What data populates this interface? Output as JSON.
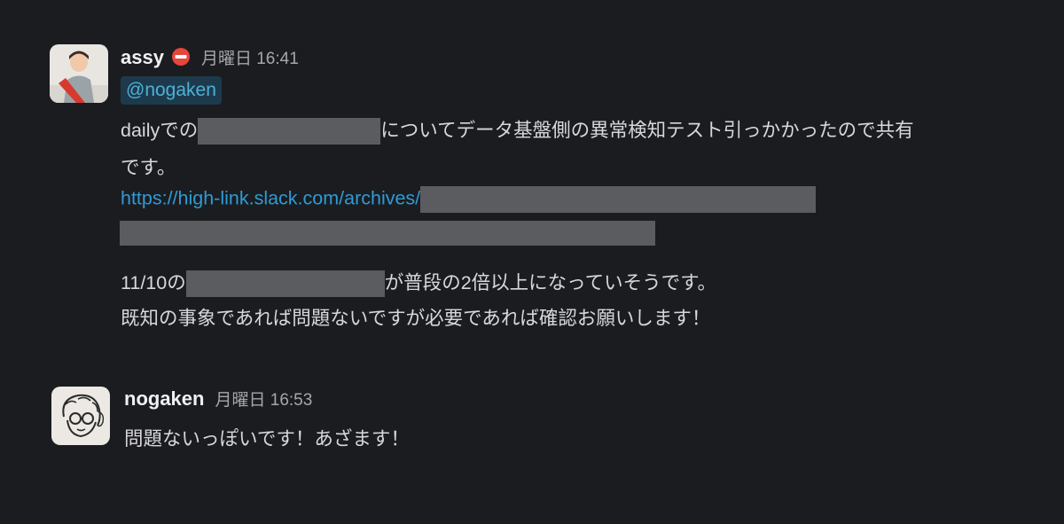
{
  "messages": [
    {
      "user": "assy",
      "status_icon": "no-entry-icon",
      "timestamp": "月曜日 16:41",
      "mention": "@nogaken",
      "line1_before": "dailyでの",
      "line1_after": "についてデータ基盤側の異常検知テスト引っかかったので共有",
      "line2": "です。",
      "link_text": "https://high-link.slack.com/archives/",
      "line5_before": "11/10の",
      "line5_after": "が普段の2倍以上になっていそうです。",
      "line6": "既知の事象であれば問題ないですが必要であれば確認お願いします！"
    },
    {
      "user": "nogaken",
      "timestamp": "月曜日 16:53",
      "text": "問題ないっぽいです！あざます！"
    }
  ],
  "colors": {
    "background": "#1b1c20",
    "link": "#2e9bd6",
    "mention_bg": "#1d3a4c",
    "mention_text": "#4fb0d6",
    "redaction": "#5b5c60",
    "status_red": "#e8453c"
  }
}
